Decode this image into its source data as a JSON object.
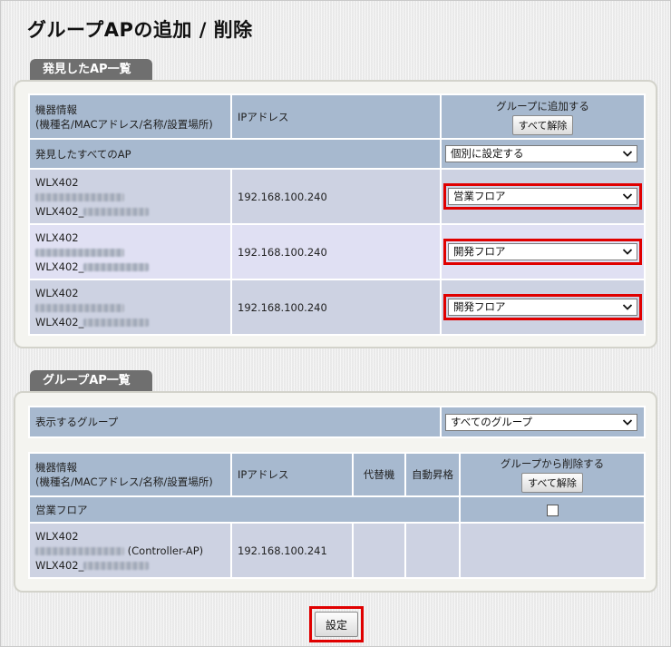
{
  "page_title": "グループAPの追加 / 削除",
  "discovered": {
    "tab_label": "発見したAP一覧",
    "col_device": "機器情報",
    "col_device_sub": "(機種名/MACアドレス/名称/設置場所)",
    "col_ip": "IPアドレス",
    "col_add": "グループに追加する",
    "clear_all": "すべて解除",
    "all_row_label": "発見したすべてのAP",
    "all_row_select": "個別に設定する",
    "rows": [
      {
        "model": "WLX402",
        "name_prefix": "WLX402_",
        "ip": "192.168.100.240",
        "group": "営業フロア"
      },
      {
        "model": "WLX402",
        "name_prefix": "WLX402_",
        "ip": "192.168.100.240",
        "group": "開発フロア"
      },
      {
        "model": "WLX402",
        "name_prefix": "WLX402_",
        "ip": "192.168.100.240",
        "group": "開発フロア"
      }
    ]
  },
  "group_ap": {
    "tab_label": "グループAP一覧",
    "show_group_label": "表示するグループ",
    "show_group_select": "すべてのグループ",
    "col_device": "機器情報",
    "col_device_sub": "(機種名/MACアドレス/名称/設置場所)",
    "col_ip": "IPアドレス",
    "col_alt": "代替機",
    "col_auto": "自動昇格",
    "col_remove": "グループから削除する",
    "clear_all": "すべて解除",
    "group_name": "営業フロア",
    "rows": [
      {
        "model": "WLX402",
        "role": "(Controller-AP)",
        "name_prefix": "WLX402_",
        "ip": "192.168.100.241"
      }
    ]
  },
  "submit_label": "設定",
  "colors": {
    "highlight": "#e00000",
    "header": "#a7b9cf",
    "row_a": "#cdd2e2",
    "row_b": "#e0e0f3",
    "tab": "#6f6f6f"
  }
}
